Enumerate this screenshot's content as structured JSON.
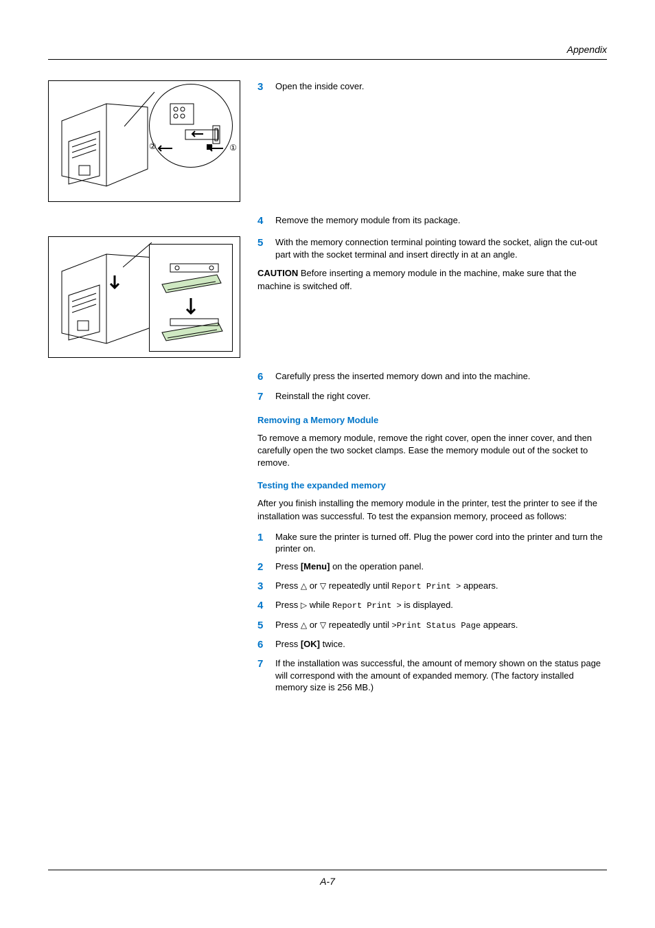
{
  "header": {
    "section": "Appendix"
  },
  "footer": {
    "page": "A-7"
  },
  "step3": {
    "text": "Open the inside cover."
  },
  "step4": {
    "text": "Remove the memory module from its package."
  },
  "step5": {
    "text": "With the memory connection terminal pointing toward the socket, align the cut-out part with the socket terminal and insert directly in at an angle."
  },
  "caution": {
    "label": "CAUTION",
    "text": "  Before inserting a memory module in the machine, make sure that the machine is switched off."
  },
  "step6": {
    "text": "Carefully press the inserted memory down and into the machine."
  },
  "step7": {
    "text": "Reinstall the right cover."
  },
  "removing": {
    "heading": "Removing a Memory Module",
    "para": "To remove a memory module, remove the right cover, open the inner cover, and then carefully open the two socket clamps. Ease the memory module out of the socket to remove."
  },
  "testing": {
    "heading": "Testing the expanded memory",
    "intro": "After you finish installing the memory module in the printer, test the printer to see if the installation was successful. To test the expansion memory, proceed as follows:",
    "s1": "Make sure the printer is turned off. Plug the power cord into the printer and turn the printer on.",
    "s2_a": "Press ",
    "s2_menu": "[Menu]",
    "s2_b": " on the operation panel.",
    "s3_a": "Press ",
    "s3_b": " or ",
    "s3_c": " repeatedly until ",
    "s3_code": "Report Print >",
    "s3_d": " appears.",
    "s4_a": "Press ",
    "s4_b": " while ",
    "s4_code": "Report Print >",
    "s4_c": " is displayed.",
    "s5_a": "Press ",
    "s5_b": " or ",
    "s5_c": " repeatedly until ",
    "s5_code": ">Print Status Page",
    "s5_d": " appears.",
    "s6_a": "Press ",
    "s6_ok": "[OK]",
    "s6_b": " twice.",
    "s7": "If the installation was successful, the amount of memory shown on the status page will correspond with the amount of expanded memory. (The factory installed memory size is 256 MB.)"
  },
  "icons": {
    "up": "△",
    "down": "▽",
    "right": "▷"
  }
}
